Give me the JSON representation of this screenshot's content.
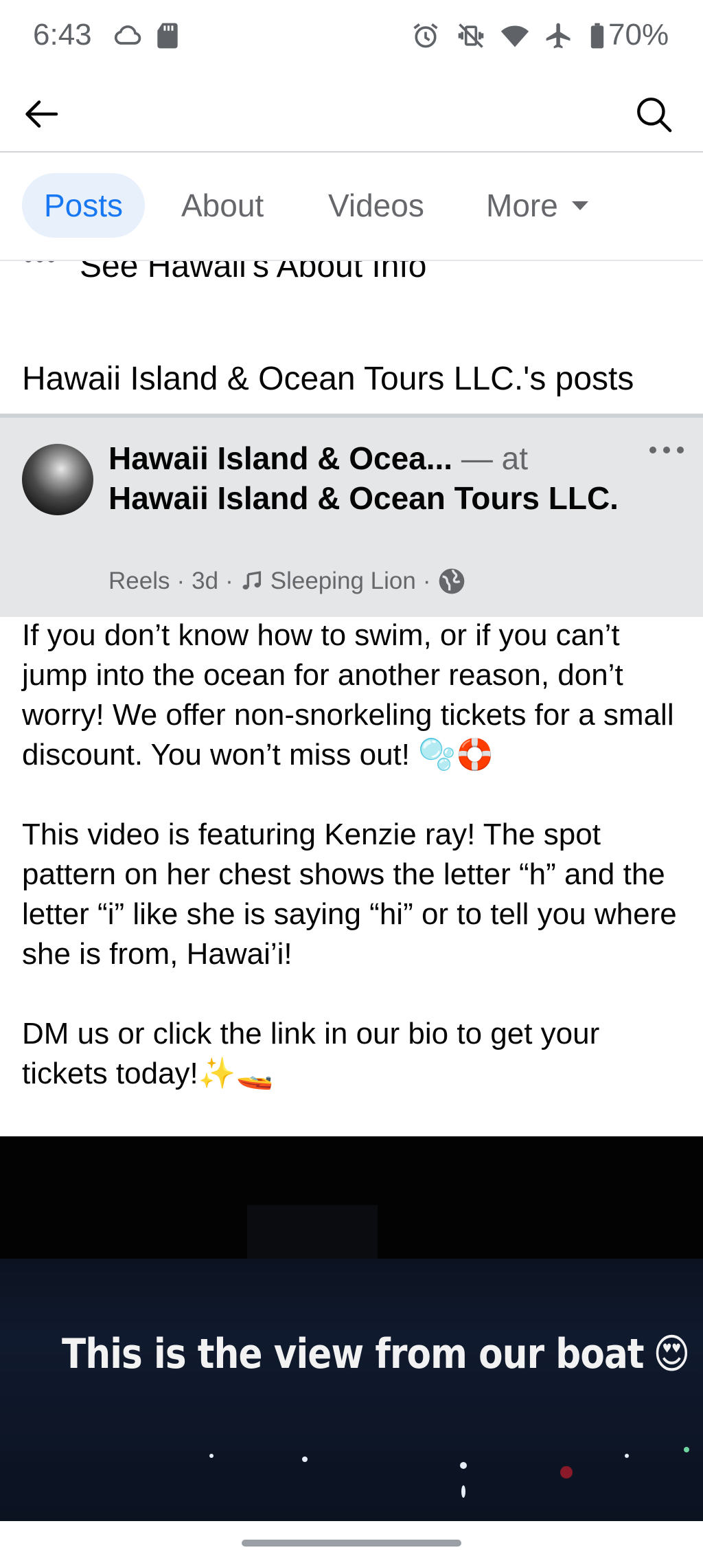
{
  "status_bar": {
    "time": "6:43",
    "battery": "70%",
    "icons": [
      "cloud-icon",
      "sd-card-icon",
      "alarm-icon",
      "vibrate-off-icon",
      "wifi-icon",
      "airplane-icon",
      "battery-icon"
    ]
  },
  "top_bar": {
    "back_icon": "arrow-left-icon",
    "search_icon": "search-icon"
  },
  "tabs": [
    {
      "label": "Posts",
      "active": true
    },
    {
      "label": "About",
      "active": false
    },
    {
      "label": "Videos",
      "active": false
    },
    {
      "label": "More",
      "active": false
    }
  ],
  "see_about": "See Hawaii's About Info",
  "posts_heading": "Hawaii Island & Ocean Tours LLC.'s posts",
  "post": {
    "author": "Hawaii Island & Ocea...",
    "at_text": " — at",
    "location": "Hawaii Island & Ocean Tours LLC.",
    "meta_type": "Reels",
    "meta_sep": "·",
    "meta_time": "3d",
    "meta_audio": "Sleeping Lion",
    "paragraphs": [
      "If you don’t know how to swim, or if you can’t jump into the ocean for another reason, don’t worry! We offer non-snorkeling tickets for a small discount. You won’t miss out! 🫧🛟",
      "This video is featuring Kenzie ray! The spot pattern on her chest shows the letter “h” and the letter “i” like she is saying “hi” or to tell you where she is from, Hawai’i!",
      "DM us or click the link in our bio to get your tickets today!✨🚤"
    ]
  },
  "video": {
    "caption": "This is the view from our boat",
    "caption_emoji": "😍"
  },
  "colors": {
    "accent": "#1877f2",
    "tab_active_bg": "#e7f0fb",
    "header_bg": "#e4e6e7",
    "secondary_text": "#65676b"
  }
}
